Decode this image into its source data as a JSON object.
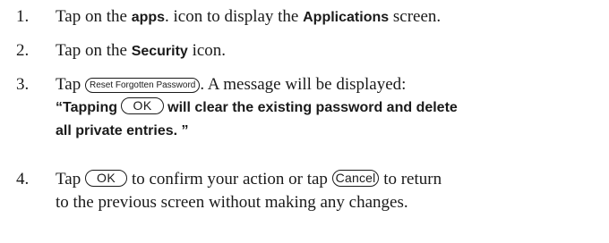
{
  "steps": [
    {
      "number": "1.",
      "pre": "Tap on the ",
      "icon_name": "apps",
      "mid": ". icon to display the ",
      "screen_name": "Applications",
      "post": " screen."
    },
    {
      "number": "2.",
      "pre": "Tap on the ",
      "icon_name": "Security",
      "post": " icon."
    },
    {
      "number": "3.",
      "pre": "Tap ",
      "button": "Reset Forgotten Password",
      "post": ". A message will be displayed:",
      "message": {
        "open_quote": "“Tapping ",
        "button": "OK",
        "line1_rest": " will clear the existing password and delete",
        "line2": "all private entries. ”"
      }
    },
    {
      "number": "4.",
      "pre": "Tap ",
      "ok_button": "OK",
      "mid": " to confirm your action or tap ",
      "cancel_button": "Cancel",
      "post": " to return",
      "line2": "to the previous screen without making any changes."
    }
  ]
}
